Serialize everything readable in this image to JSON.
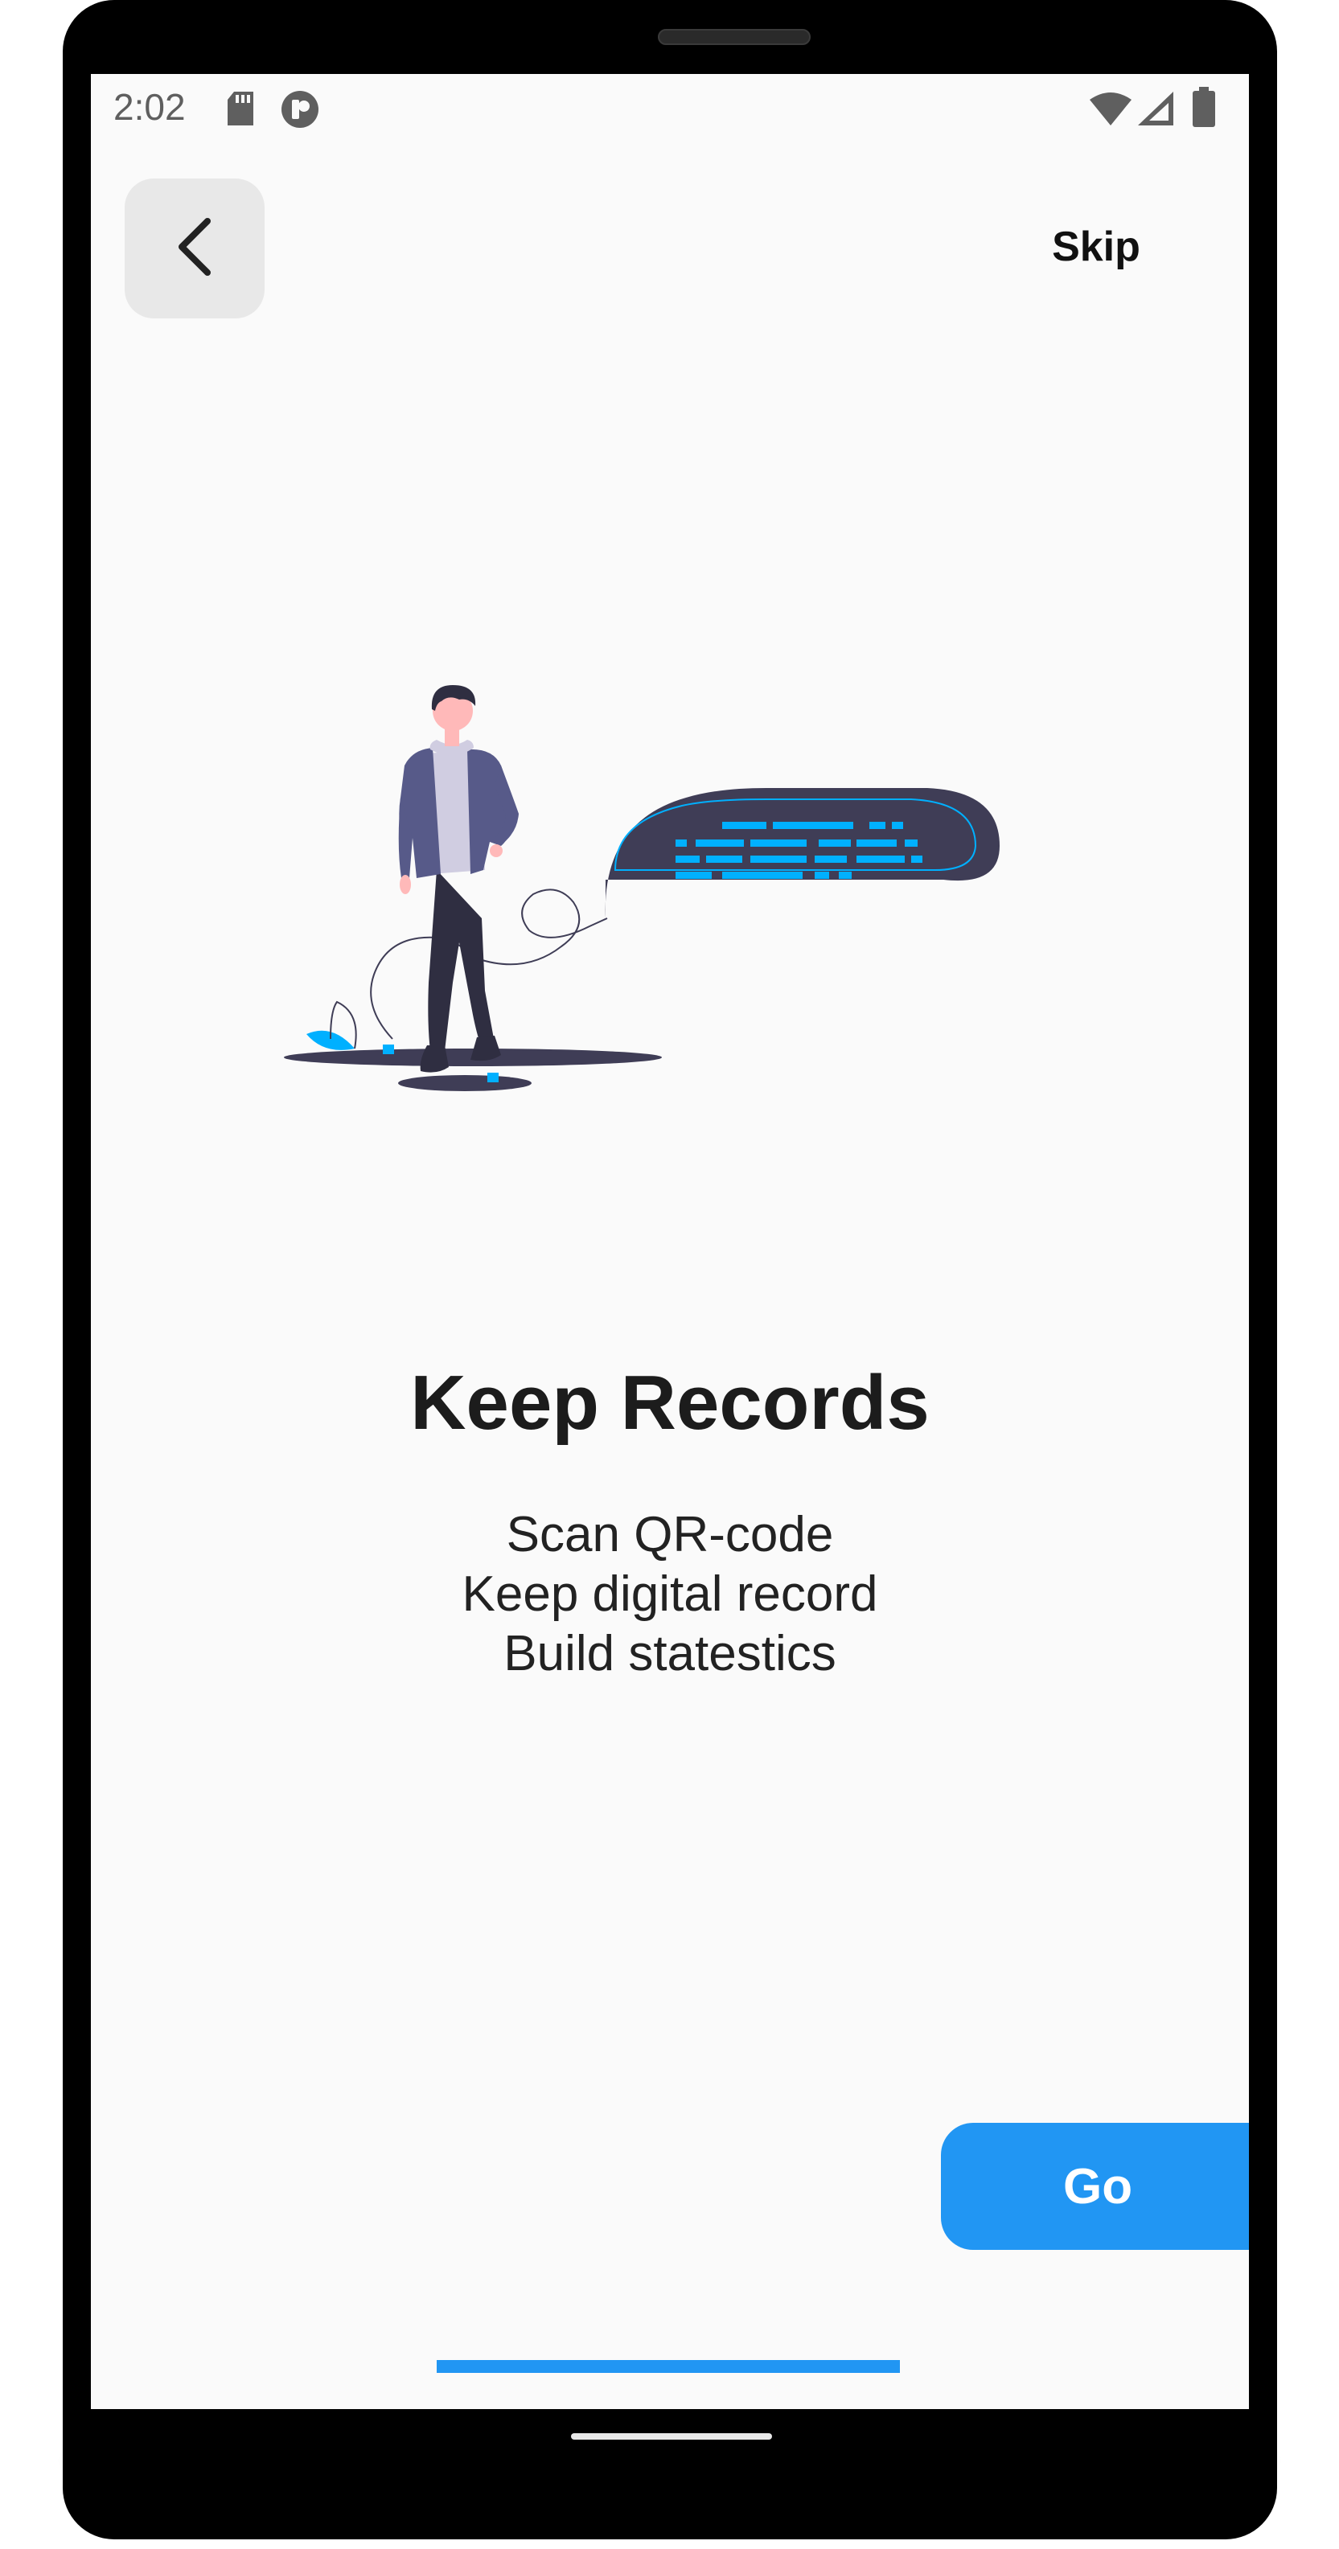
{
  "status_bar": {
    "time": "2:02",
    "icons": [
      "sd-card-icon",
      "app-notification-icon",
      "wifi-icon",
      "signal-icon",
      "battery-icon"
    ]
  },
  "header": {
    "back_icon": "chevron-left-icon",
    "skip_label": "Skip"
  },
  "illustration": {
    "description_icon": "person-with-speech-bubble-illustration"
  },
  "content": {
    "title": "Keep Records",
    "lines": [
      "Scan QR-code",
      "Keep digital record",
      "Build statestics"
    ]
  },
  "actions": {
    "go_label": "Go"
  },
  "progress": {
    "value_fraction": 1.0
  },
  "colors": {
    "accent": "#2196f3",
    "background": "#fafafa",
    "illustration_dark": "#3f3d56",
    "illustration_accent": "#00b0ff",
    "illustration_jacket": "#575a89"
  }
}
